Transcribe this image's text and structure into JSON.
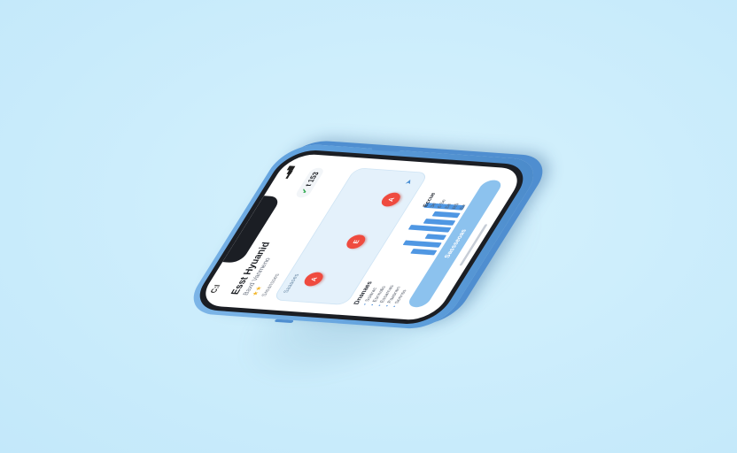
{
  "status_bar": {
    "time": "C:I"
  },
  "header": {
    "title": "Esst Hyuanid",
    "subtitle": "Baxd Vanmeno",
    "rating": "★★",
    "section_label": "Sreansses"
  },
  "timer": {
    "icon": "check-icon",
    "value": "t 153"
  },
  "card": {
    "label": "Saaaoes",
    "dots": [
      {
        "label": "A"
      },
      {
        "label": "E"
      },
      {
        "label": "A"
      }
    ],
    "corner_icon": "arrow-icon"
  },
  "stats": {
    "title": "Dnanaes",
    "legend": [
      "Ssiarac",
      "Esnnatis",
      "Essarnas",
      "Paasnen",
      "Sonnss"
    ],
    "bars": [
      0.55,
      0.85,
      0.45,
      0.95,
      0.7,
      0.6,
      0.9
    ],
    "readout_title": "Eccue",
    "readout": [
      "3e",
      "6 Se",
      "Ee",
      "RS",
      "Ee"
    ]
  },
  "cta": {
    "label": "Sassseoas"
  },
  "colors": {
    "background": "#cdeefc",
    "device": "#5e9fdc",
    "accent": "#4f97e3",
    "dot": "#ef4b3f",
    "button": "#8cc2ee"
  }
}
